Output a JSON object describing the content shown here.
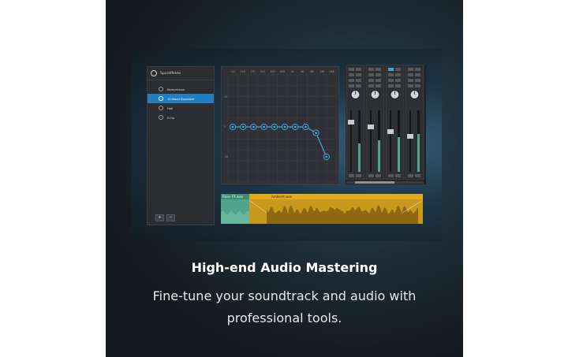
{
  "fx_panel": {
    "title": "Spureffekte",
    "items": [
      {
        "label": "Kompressor",
        "active": false
      },
      {
        "label": "10-Band Equalizer",
        "active": true
      },
      {
        "label": "Hall",
        "active": false
      },
      {
        "label": "Echo",
        "active": false
      }
    ],
    "add_label": "+",
    "remove_label": "−"
  },
  "eq": {
    "freq_labels": [
      "112",
      "125",
      "170",
      "215",
      "300",
      "500",
      "1K",
      "4K",
      "8K",
      "13K",
      "16K"
    ],
    "db_labels": [
      "10",
      "0",
      "-10"
    ],
    "band_values": [
      0,
      0,
      0,
      0,
      0,
      0,
      0,
      0,
      -2,
      -10
    ]
  },
  "timeline": {
    "clip1_label": "River FX.wav",
    "clip2_label": "Ambient.wav"
  },
  "headline": "High-end Audio Mastering",
  "subline1": "Fine-tune your soundtrack and audio with",
  "subline2": "professional tools.",
  "colors": {
    "accent": "#1f7fc2",
    "eq_line": "#3fa7e0",
    "clip_green": "#4fa58a",
    "clip_yellow": "#e0ab1e"
  }
}
